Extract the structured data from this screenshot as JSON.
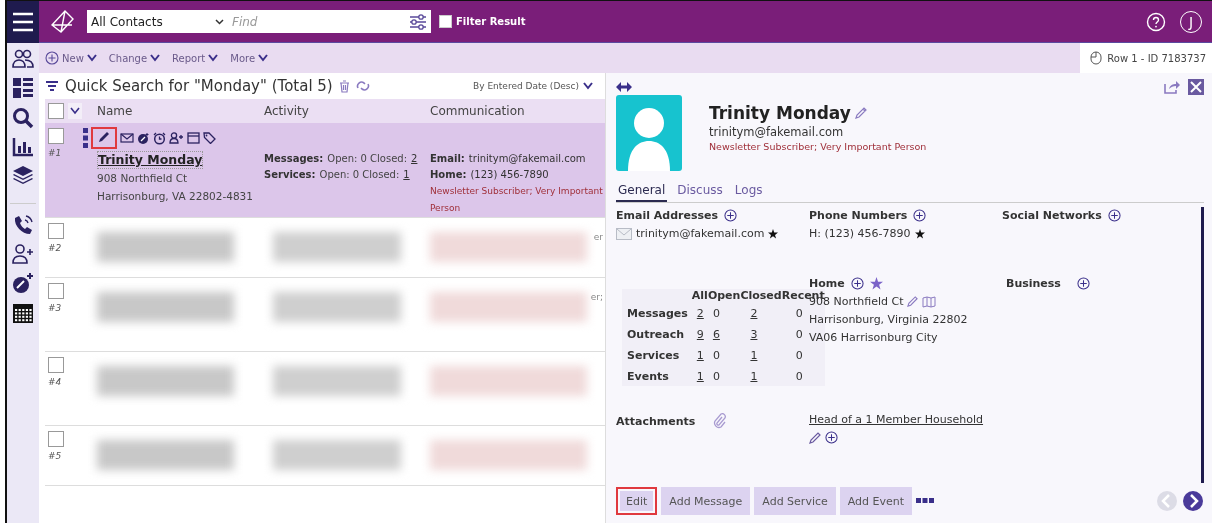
{
  "top_bar": {
    "view": "All Contacts",
    "find_placeholder": "Find",
    "filter": {
      "label": "Filter Result",
      "checked": false
    },
    "user_initial": "J"
  },
  "rail": [
    {
      "kind": "people"
    },
    {
      "kind": "list"
    },
    {
      "kind": "search"
    },
    {
      "kind": "chart"
    },
    {
      "kind": "layers"
    },
    {
      "kind": "phone"
    },
    {
      "kind": "person-add"
    },
    {
      "kind": "gauge-add"
    },
    {
      "kind": "calendar"
    }
  ],
  "toolbar": {
    "menus": [
      {
        "label": "New",
        "kind": "add"
      },
      {
        "label": "Change",
        "kind": "plain"
      },
      {
        "label": "Report",
        "kind": "plain"
      },
      {
        "label": "More",
        "kind": "plain"
      }
    ],
    "row_info": "Row 1 - ID 7183737"
  },
  "list": {
    "title": "Quick Search for \"Monday\" (Total 5)",
    "sort": "By Entered Date (Desc)",
    "columns": [
      "Name",
      "Activity",
      "Communication"
    ],
    "select_all_checked": false,
    "rows": [
      {
        "number": "#1",
        "checked": false,
        "selected": true,
        "blurred": false,
        "edit_highlighted": true,
        "name": "Trinity Monday",
        "address": [
          "908 Northfield Ct",
          "Harrisonburg, VA 22802-4831"
        ],
        "activity": [
          {
            "label": "Messages:",
            "text": "Open: 0 Closed:",
            "count": "2"
          },
          {
            "label": "Services:",
            "text": "Open: 0 Closed:",
            "count": "1"
          }
        ],
        "communication": [
          {
            "label": "Email:",
            "value": "trinitym@fakemail.com"
          },
          {
            "label": "Home:",
            "value": "(123) 456-7890"
          }
        ],
        "tags": "Newsletter Subscriber; Very Important Person"
      },
      {
        "number": "#2",
        "checked": false,
        "selected": false,
        "blurred": true,
        "fragment": "er"
      },
      {
        "number": "#3",
        "checked": false,
        "selected": false,
        "blurred": true,
        "fragment": "er;"
      },
      {
        "number": "#4",
        "checked": false,
        "selected": false,
        "blurred": true
      },
      {
        "number": "#5",
        "checked": false,
        "selected": false,
        "blurred": true
      }
    ]
  },
  "detail": {
    "name": "Trinity Monday",
    "email": "trinitym@fakemail.com",
    "tags": "Newsletter Subscriber; Very Important Person",
    "tabs": [
      {
        "label": "General",
        "selected": true
      },
      {
        "label": "Discuss",
        "selected": false
      },
      {
        "label": "Logs",
        "selected": false
      }
    ],
    "email_section": {
      "title": "Email Addresses",
      "items": [
        {
          "text": "trinitym@fakemail.com",
          "primary": true
        }
      ]
    },
    "phone_section": {
      "title": "Phone Numbers",
      "items": [
        {
          "text": "H: (123) 456-7890",
          "primary": true
        }
      ]
    },
    "social_title": "Social Networks",
    "stats": {
      "columns": [
        "All",
        "Open",
        "Closed",
        "Recent"
      ],
      "rows": [
        {
          "label": "Messages",
          "cells": [
            {
              "value": "2",
              "link": true
            },
            {
              "value": "0",
              "link": false
            },
            {
              "value": "2",
              "link": true
            },
            {
              "value": "0",
              "link": false
            }
          ]
        },
        {
          "label": "Outreach",
          "cells": [
            {
              "value": "9",
              "link": true
            },
            {
              "value": "6",
              "link": true
            },
            {
              "value": "3",
              "link": true
            },
            {
              "value": "0",
              "link": false
            }
          ]
        },
        {
          "label": "Services",
          "cells": [
            {
              "value": "1",
              "link": true
            },
            {
              "value": "0",
              "link": false
            },
            {
              "value": "1",
              "link": true
            },
            {
              "value": "0",
              "link": false
            }
          ]
        },
        {
          "label": "Events",
          "cells": [
            {
              "value": "1",
              "link": true
            },
            {
              "value": "0",
              "link": false
            },
            {
              "value": "1",
              "link": true
            },
            {
              "value": "0",
              "link": false
            }
          ]
        }
      ]
    },
    "home": {
      "title": "Home",
      "primary": true,
      "lines": [
        "908 Northfield Ct",
        "Harrisonburg, Virginia 22802",
        "VA06 Harrisonburg City"
      ]
    },
    "business_title": "Business",
    "attachments_title": "Attachments",
    "household": "Head of a 1 Member Household",
    "buttons": [
      {
        "label": "Edit",
        "highlighted": true
      },
      {
        "label": "Add Message",
        "highlighted": false
      },
      {
        "label": "Add Service",
        "highlighted": false
      },
      {
        "label": "Add Event",
        "highlighted": false
      }
    ],
    "nav": {
      "prev_disabled": true
    }
  }
}
